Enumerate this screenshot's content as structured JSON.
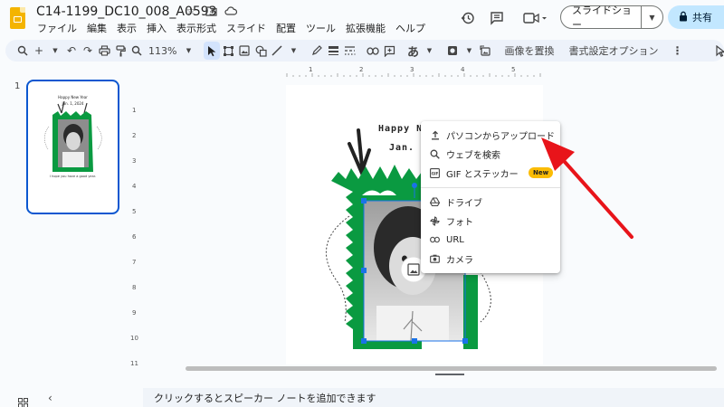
{
  "document": {
    "title": "C14-1199_DC10_008_A0593"
  },
  "menubar": [
    "ファイル",
    "編集",
    "表示",
    "挿入",
    "表示形式",
    "スライド",
    "配置",
    "ツール",
    "拡張機能",
    "ヘルプ"
  ],
  "header": {
    "slideshow_label": "スライドショー",
    "share_label": "共有"
  },
  "toolbar": {
    "zoom": "113%",
    "replace_image_label": "画像を置換",
    "format_options_label": "書式設定オプション",
    "input_tool_glyph": "あ"
  },
  "filmstrip": {
    "slide_number": "1",
    "thumb_title": "Happy New Year",
    "thumb_date": "Jan. 1, 2024",
    "thumb_caption": "I hope you have a good year."
  },
  "slide": {
    "title_partial": "Happy Ne",
    "date_partial": "Jan. 1,"
  },
  "ruler": {
    "top_ticks": [
      "1",
      "2",
      "3",
      "4",
      "5"
    ],
    "left_ticks": [
      "1",
      "2",
      "3",
      "4",
      "5",
      "6",
      "7",
      "8",
      "9",
      "10",
      "11"
    ]
  },
  "image_menu": {
    "items": [
      {
        "icon": "upload-icon",
        "label": "パソコンからアップロード"
      },
      {
        "icon": "search-icon",
        "label": "ウェブを検索"
      },
      {
        "icon": "gif-icon",
        "label": "GIF とステッカー",
        "badge": "New"
      },
      {
        "icon": "drive-icon",
        "label": "ドライブ"
      },
      {
        "icon": "photos-icon",
        "label": "フォト"
      },
      {
        "icon": "link-icon",
        "label": "URL"
      },
      {
        "icon": "camera-icon",
        "label": "カメラ"
      }
    ]
  },
  "notes": {
    "placeholder": "クリックするとスピーカー ノートを追加できます"
  },
  "colors": {
    "accent_blue": "#0b57d0",
    "frame_green": "#0a9a41",
    "arrow_red": "#e8141a",
    "badge_yellow": "#fbbc04"
  }
}
